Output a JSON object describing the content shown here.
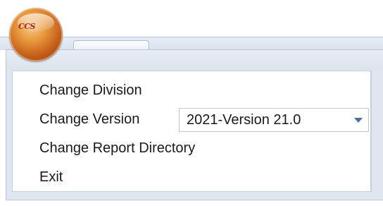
{
  "app_menu": {
    "logo_text": "CCS",
    "items": {
      "change_division": "Change Division",
      "change_version": "Change Version",
      "change_report_directory": "Change Report Directory",
      "exit": "Exit"
    },
    "version_select": {
      "selected": "2021-Version 21.0"
    }
  },
  "colors": {
    "orb": "#c6601a",
    "panel_bg": "#dfe6ef",
    "border": "#b9c6d6",
    "dropdown_arrow": "#4a6f9e"
  },
  "icons": {
    "app_button": "app-orb-icon",
    "dropdown": "chevron-down-icon"
  }
}
